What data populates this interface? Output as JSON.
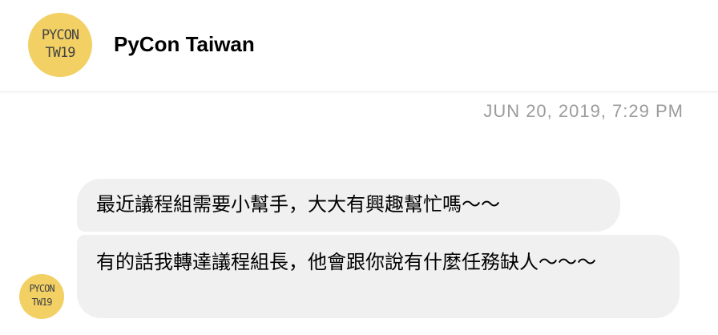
{
  "header": {
    "title": "PyCon Taiwan",
    "logo_line1": "PYCON",
    "logo_line2": "TW19"
  },
  "conversation": {
    "timestamp": "JUN 20, 2019, 7:29 PM",
    "messages": [
      {
        "text": "最近議程組需要小幫手，大大有興趣幫忙嗎～～"
      },
      {
        "text": "有的話我轉達議程組長，他會跟你說有什麼任務缺人～～～"
      }
    ],
    "avatar_line1": "PYCON",
    "avatar_line2": "TW19"
  },
  "colors": {
    "logo_bg": "#f2d064",
    "bubble_bg": "#f0f0f0",
    "timestamp": "#9b9b9b"
  }
}
